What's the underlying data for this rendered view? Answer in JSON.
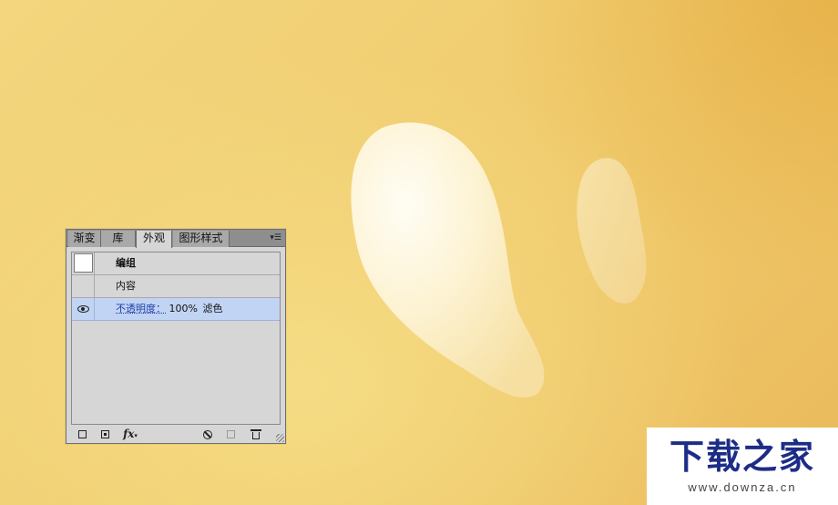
{
  "panel": {
    "tabs": [
      {
        "label": "渐变"
      },
      {
        "label": "库"
      },
      {
        "label": "外观"
      },
      {
        "label": "图形样式"
      }
    ],
    "active_tab": "外观",
    "menu_icon": "panel-menu-icon",
    "rows": {
      "group": {
        "label": "编组"
      },
      "contents": {
        "label": "内容"
      },
      "opacity": {
        "name": "不透明度",
        "colon": "：",
        "value": "100%",
        "mode": "滤色"
      }
    },
    "toolbar_icons": [
      "add-new-stroke-icon",
      "add-new-fill-icon",
      "add-new-effect-icon",
      "clear-appearance-icon",
      "duplicate-item-icon",
      "delete-item-icon"
    ],
    "fx_label": "fx"
  },
  "watermark": {
    "title": "下载之家",
    "url": "www.downza.cn"
  },
  "colors": {
    "background": "#f0cb6d",
    "shape_highlight": "#fffcf0",
    "selection": "#c2d4f3",
    "watermark_text": "#1d2d86"
  }
}
